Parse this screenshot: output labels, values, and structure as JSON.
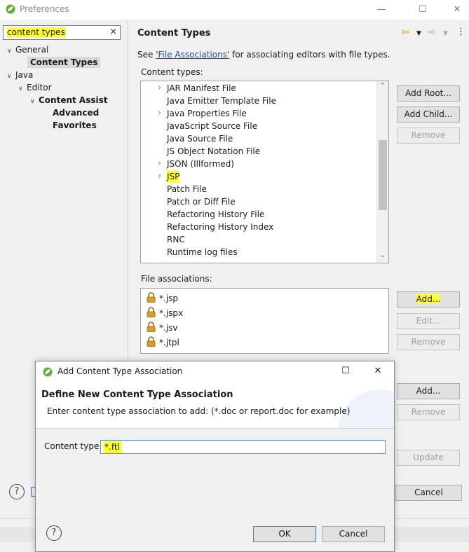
{
  "preferences": {
    "title": "Preferences",
    "filter_value": "content types",
    "filter_clear": "×",
    "tree": {
      "general": "General",
      "content_types": "Content Types",
      "java": "Java",
      "editor": "Editor",
      "content_assist": "Content Assist",
      "advanced": "Advanced",
      "favorites": "Favorites"
    },
    "page_title": "Content Types",
    "see_prefix": "See ",
    "see_link": "'File Associations'",
    "see_suffix": " for associating editors with file types.",
    "content_types_label": "Content types:",
    "content_types": [
      {
        "label": "JAR Manifest File",
        "expandable": true
      },
      {
        "label": "Java Emitter Template File",
        "expandable": false
      },
      {
        "label": "Java Properties File",
        "expandable": true
      },
      {
        "label": "JavaScript Source File",
        "expandable": false
      },
      {
        "label": "Java Source File",
        "expandable": false
      },
      {
        "label": "JS Object Notation File",
        "expandable": false
      },
      {
        "label": "JSON (Illformed)",
        "expandable": true
      },
      {
        "label": "JSP",
        "expandable": true,
        "highlighted": true
      },
      {
        "label": "Patch File",
        "expandable": false
      },
      {
        "label": "Patch or Diff File",
        "expandable": false
      },
      {
        "label": "Refactoring History File",
        "expandable": false
      },
      {
        "label": "Refactoring History Index",
        "expandable": false
      },
      {
        "label": "RNC",
        "expandable": false
      },
      {
        "label": "Runtime log files",
        "expandable": false
      }
    ],
    "content_buttons": {
      "add_root": "Add Root...",
      "add_child": "Add Child...",
      "remove": "Remove"
    },
    "file_assoc_label": "File associations:",
    "file_associations": [
      "*.jsp",
      "*.jspx",
      "*.jsv",
      "*.jtpl"
    ],
    "file_buttons": {
      "add": "Add...",
      "edit": "Edit...",
      "remove": "Remove"
    },
    "encoding_buttons": {
      "add": "Add...",
      "remove": "Remove"
    },
    "update_button": "Update",
    "cancel_button": "Cancel",
    "help_icon": "?"
  },
  "dialog": {
    "title": "Add Content Type Association",
    "heading": "Define New Content Type Association",
    "description": "Enter content type association to add: (*.doc or report.doc for example)",
    "field_label": "Content type:",
    "field_value": "*.ftl",
    "ok": "OK",
    "cancel": "Cancel",
    "help_icon": "?"
  },
  "colors": {
    "highlight": "#ffff3c",
    "link": "#1a4fa8",
    "focus_border": "#5a8fd4",
    "lock": "#d9a11a"
  }
}
